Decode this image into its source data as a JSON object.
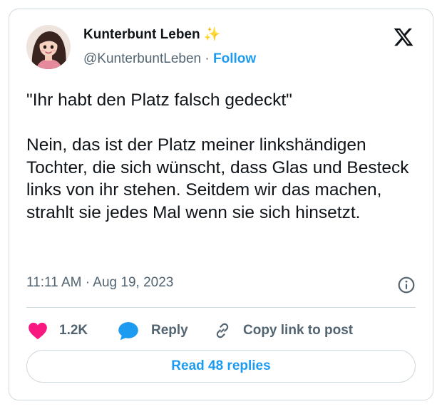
{
  "author": {
    "display_name": "Kunterbunt Leben ✨",
    "handle": "@KunterbuntLeben",
    "separator": " · ",
    "follow_label": "Follow",
    "avatar_icon": "cartoon-woman-avatar"
  },
  "platform_logo": "x-logo-icon",
  "tweet": {
    "text": "\"Ihr habt den Platz falsch gedeckt\"\n\nNein, das ist der Platz meiner linkshändigen Tochter, die sich wünscht, dass Glas und Besteck links von ihr stehen. Seitdem wir das machen, strahlt sie jedes Mal wenn sie sich hinsetzt.",
    "timestamp": "11:11 AM · Aug 19, 2023"
  },
  "actions": {
    "like_count": "1.2K",
    "reply_label": "Reply",
    "copy_link_label": "Copy link to post"
  },
  "read_replies_label": "Read 48 replies",
  "colors": {
    "accent": "#1d9bf0",
    "like": "#f91880",
    "text": "#0f1419",
    "muted": "#536471",
    "border": "#cfd9de"
  }
}
